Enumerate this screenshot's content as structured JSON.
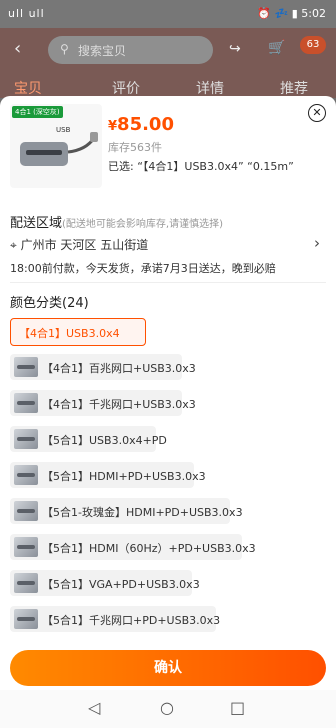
{
  "status": {
    "signal": "ull ull",
    "alarm_and_time": "⏰ 💤 ▮ 5:02"
  },
  "background": {
    "search_placeholder": "搜索宝贝",
    "cart_badge": "63",
    "tabs": [
      "宝贝",
      "评价",
      "详情",
      "推荐"
    ]
  },
  "product": {
    "tag": "4合1 (深空灰)",
    "usb_label": "USB",
    "currency": "¥",
    "price": "85.00",
    "stock": "库存563件",
    "selected": "已选: “【4合1】USB3.0x4” “0.15m”"
  },
  "delivery": {
    "title": "配送区域",
    "hint": "(配送地可能会影响库存,请谨慎选择)",
    "address": "广州市 天河区 五山街道",
    "note": "18:00前付款，今天发货，承诺7月3日送达，晚到必赔"
  },
  "colors": {
    "title": "颜色分类(24)",
    "options": [
      "【4合1】USB3.0x4",
      "【4合1】百兆网口+USB3.0x3",
      "【4合1】千兆网口+USB3.0x3",
      "【5合1】USB3.0x4+PD",
      "【5合1】HDMI+PD+USB3.0x3",
      "【5合1-玫瑰金】HDMI+PD+USB3.0x3",
      "【5合1】HDMI（60Hz）+PD+USB3.0x3",
      "【5合1】VGA+PD+USB3.0x3",
      "【5合1】千兆网口+PD+USB3.0x3"
    ]
  },
  "confirm_label": "确认"
}
